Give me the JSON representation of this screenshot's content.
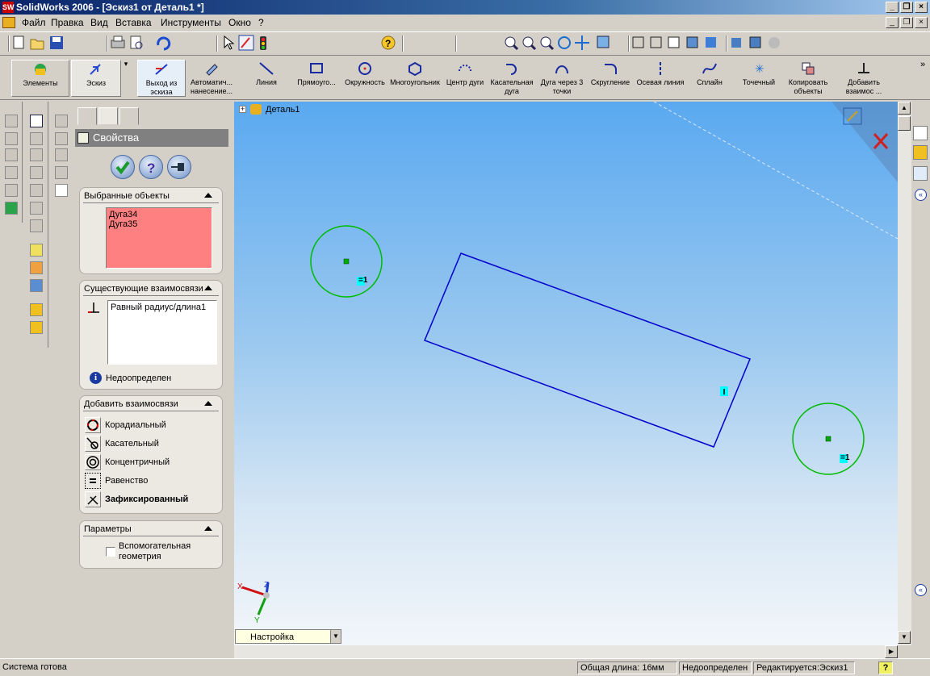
{
  "window": {
    "title": "SolidWorks 2006 - [Эскиз1 от Деталь1 *]",
    "logo": "SW"
  },
  "menu": {
    "items": [
      "Файл",
      "Правка",
      "Вид",
      "Вставка",
      "Инструменты",
      "Окно",
      "?"
    ]
  },
  "toolbar2": {
    "features_label": "Элементы",
    "sketch_label": "Эскиз",
    "exit_sketch": "Выход из эскиза",
    "auto_dim": "Автоматич... нанесение...",
    "line": "Линия",
    "rectangle": "Прямоуго...",
    "circle": "Окружность",
    "polygon": "Многоугольник",
    "center_arc": "Центр дуги",
    "tangent_arc": "Касательная дуга",
    "arc_3pt": "Дуга через 3 точки",
    "fillet": "Скругление",
    "centerline": "Осевая линия",
    "spline": "Сплайн",
    "point": "Точечный",
    "copy": "Копировать объекты",
    "add_relation": "Добавить взаимос ..."
  },
  "property_manager": {
    "title": "Свойства",
    "selected_title": "Выбранные объекты",
    "selected_items": [
      "Дуга34",
      "Дуга35"
    ],
    "existing_title": "Существующие взаимосвязи",
    "existing_items": [
      "Равный радиус/длина1"
    ],
    "status": "Недоопределен",
    "add_title": "Добавить взаимосвязи",
    "relations": [
      "Корадиальный",
      "Касательный",
      "Концентричный",
      "Равенство",
      "Зафиксированный"
    ],
    "params_title": "Параметры",
    "construction_label": "Вспомогательная геометрия",
    "construction_checked": false
  },
  "tree": {
    "root": "Деталь1"
  },
  "graphics": {
    "relation_badge": "=1",
    "axis_x": "X",
    "axis_y": "Y",
    "axis_z": "Z",
    "config": "Настройка"
  },
  "statusbar": {
    "ready": "Система готова",
    "length": "Общая длина: 16мм",
    "state": "Недоопределен",
    "editing": "Редактируется:Эскиз1",
    "help": "?"
  },
  "colors": {
    "sketch_green": "#00bb00",
    "sketch_blue": "#0000cc",
    "selected_list": "#ff8080",
    "titlebar": "#0a246a"
  }
}
